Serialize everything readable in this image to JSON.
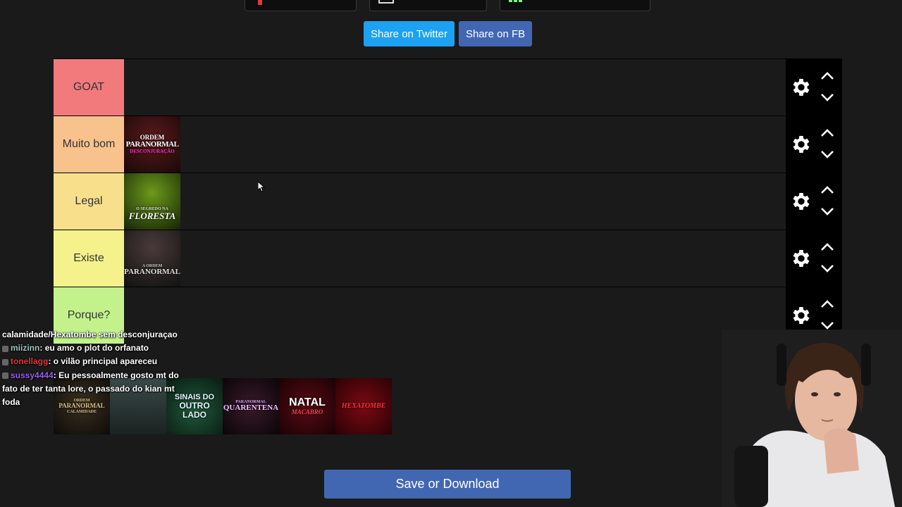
{
  "share": {
    "twitter_label": "Share on Twitter",
    "fb_label": "Share on FB"
  },
  "tiers": [
    {
      "label": "GOAT",
      "color": "#f27a7d"
    },
    {
      "label": "Muito bom",
      "color": "#f8c28c"
    },
    {
      "label": "Legal",
      "color": "#f8df8c"
    },
    {
      "label": "Existe",
      "color": "#f5f28c"
    },
    {
      "label": "Porque?",
      "color": "#c3f28c"
    }
  ],
  "tier_items": {
    "muito_bom": [
      {
        "line1": "ORDEM",
        "line2": "PARANORMAL",
        "line3": "DESCONJURAÇÃO"
      }
    ],
    "legal": [
      {
        "line1": "O SEGREDO NA",
        "line2": "FLORESTA"
      }
    ],
    "existe": [
      {
        "line1": "A ORDEM",
        "line2": "PARANORMAL"
      }
    ]
  },
  "pool_items": [
    {
      "line1": "ORDEM",
      "line2": "PARANORMAL",
      "line3": "CALAMIDADE"
    },
    {
      "line1": "",
      "line2": "",
      "line3": ""
    },
    {
      "line1": "SINAIS DO",
      "line2": "OUTRO LADO",
      "line3": ""
    },
    {
      "line1": "PARANORMAL",
      "line2": "QUARENTENA",
      "line3": ""
    },
    {
      "line1": "NATAL",
      "line2": "MACABRO",
      "line3": ""
    },
    {
      "line1": "HEXATOMBE",
      "line2": "",
      "line3": ""
    }
  ],
  "icons": {
    "settings": "gear-icon",
    "move_up": "chevron-up-icon",
    "move_down": "chevron-down-icon",
    "pointer": "cursor-icon"
  },
  "save_label": "Save or Download",
  "chat": [
    {
      "user": "",
      "color": "#ffffff",
      "message": "calamidade/Hexatombe sem desconjuraçao"
    },
    {
      "user": "miizinn",
      "color": "#9ec3c3",
      "message": "eu amo o plot do orfanato"
    },
    {
      "user": "tonellagg",
      "color": "#e0353b",
      "message": "o vilão principal apareceu"
    },
    {
      "user": "sussy4444",
      "color": "#9b59f0",
      "message": "Eu pessoalmente gosto mt do fato de ter tanta lore, o passado do kian mt foda"
    }
  ]
}
